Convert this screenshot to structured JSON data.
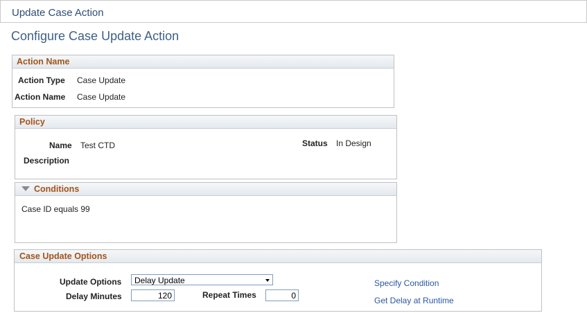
{
  "window": {
    "title": "Update Case Action"
  },
  "page": {
    "title": "Configure Case Update Action"
  },
  "action_name": {
    "header": "Action Name",
    "action_type_label": "Action Type",
    "action_type_value": "Case Update",
    "action_name_label": "Action Name",
    "action_name_value": "Case Update"
  },
  "policy": {
    "header": "Policy",
    "name_label": "Name",
    "name_value": "Test CTD",
    "status_label": "Status",
    "status_value": "In Design",
    "description_label": "Description"
  },
  "conditions": {
    "header": "Conditions",
    "text": "Case ID equals 99"
  },
  "case_update_options": {
    "header": "Case Update Options",
    "update_options_label": "Update Options",
    "update_options_value": "Delay Update",
    "delay_minutes_label": "Delay Minutes",
    "delay_minutes_value": "120",
    "repeat_times_label": "Repeat Times",
    "repeat_times_value": "0",
    "specify_condition_link": "Specify Condition",
    "get_delay_link": "Get Delay at Runtime"
  }
}
